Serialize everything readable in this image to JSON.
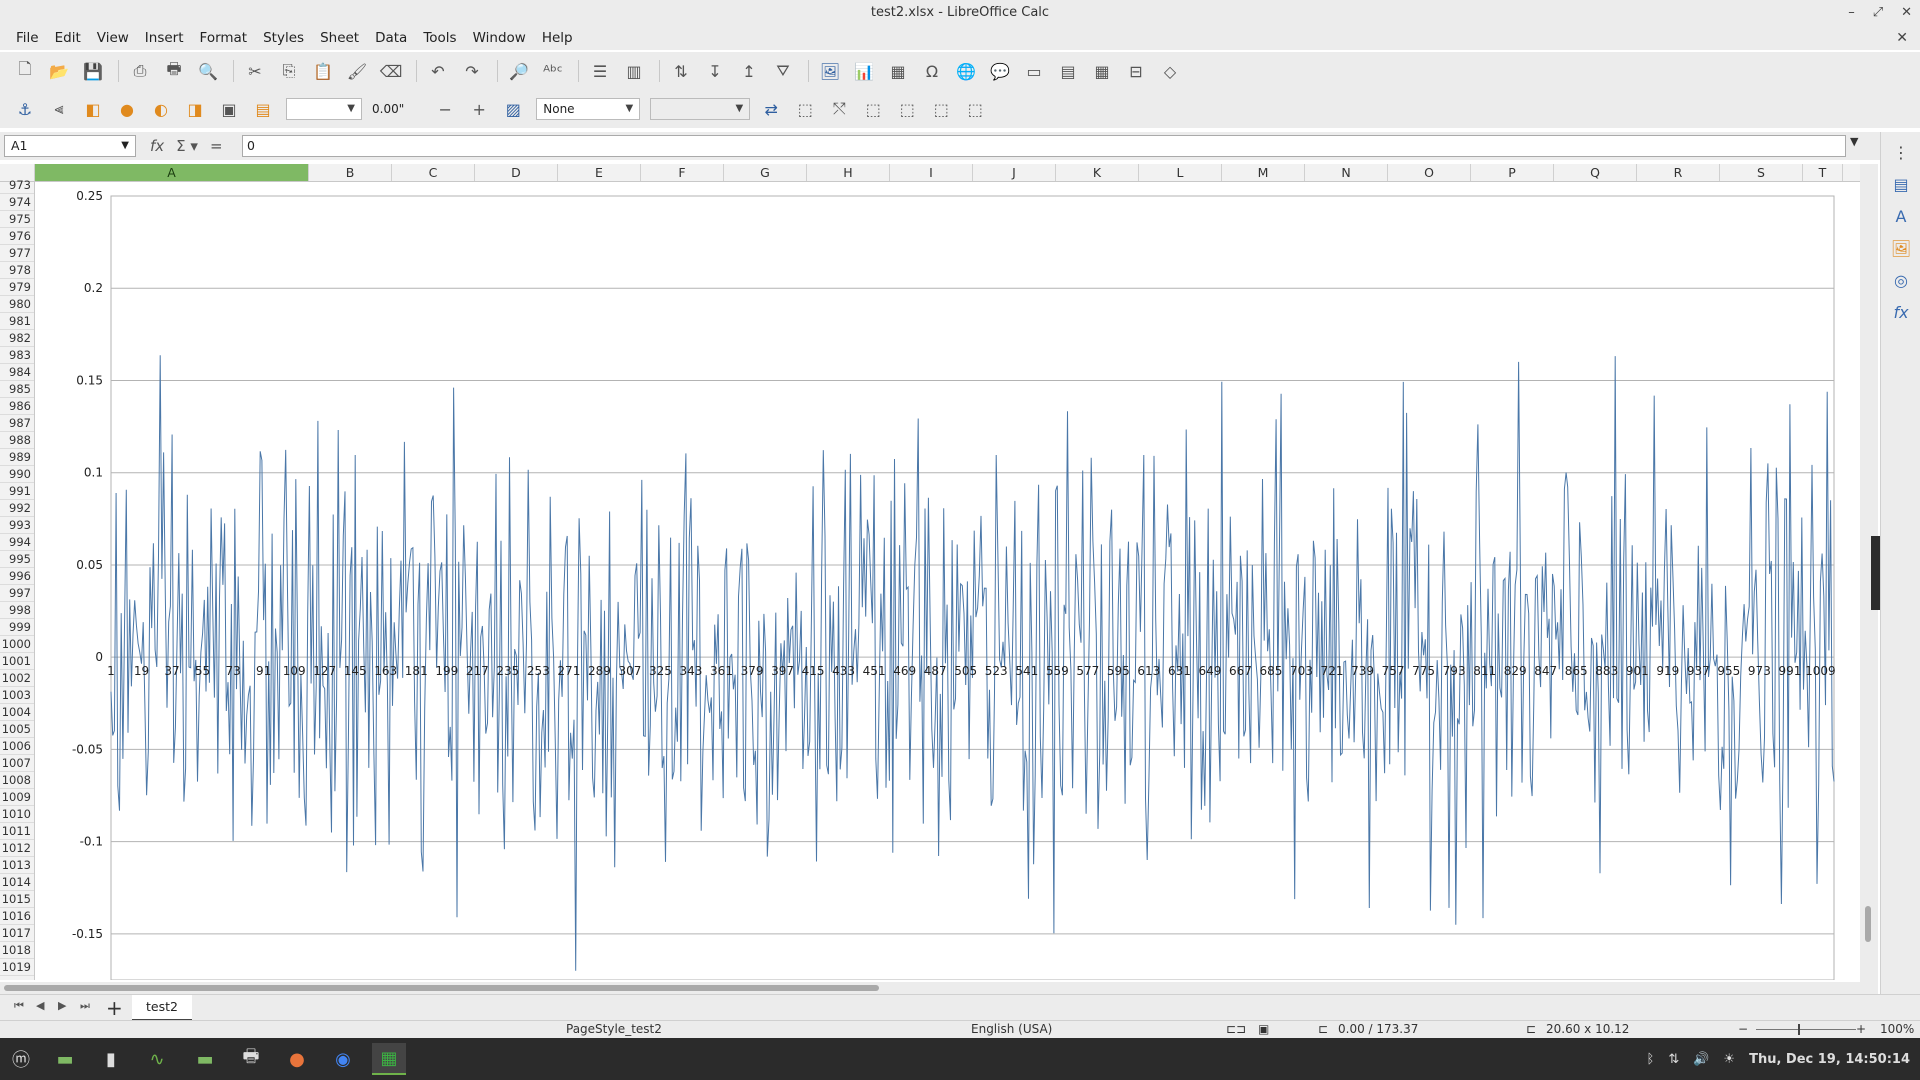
{
  "window": {
    "title": "test2.xlsx - LibreOffice Calc"
  },
  "menu": [
    "File",
    "Edit",
    "View",
    "Insert",
    "Format",
    "Styles",
    "Sheet",
    "Data",
    "Tools",
    "Window",
    "Help"
  ],
  "toolbar2": {
    "font_size_value": "0.00\"",
    "line_style_value": "None"
  },
  "formula_bar": {
    "cell_ref": "A1",
    "formula_value": "0",
    "icons": [
      "fx-icon",
      "sum-icon",
      "equals-icon"
    ]
  },
  "columns": [
    "A",
    "B",
    "C",
    "D",
    "E",
    "F",
    "G",
    "H",
    "I",
    "J",
    "K",
    "L",
    "M",
    "N",
    "O",
    "P",
    "Q",
    "R",
    "S",
    "T"
  ],
  "rows": {
    "first": 973,
    "last": 1019
  },
  "chart_data": {
    "type": "line",
    "ylim": [
      -0.175,
      0.25
    ],
    "yticks": [
      "0.25",
      "0.2",
      "0.15",
      "0.1",
      "0.05",
      "0",
      "-0.05",
      "-0.1",
      "-0.15"
    ],
    "xtick_labels": [
      "1",
      "19",
      "37",
      "55",
      "73",
      "91",
      "109",
      "127",
      "145",
      "163",
      "181",
      "199",
      "217",
      "235",
      "253",
      "271",
      "289",
      "307",
      "325",
      "343",
      "361",
      "379",
      "397",
      "415",
      "433",
      "451",
      "469",
      "487",
      "505",
      "523",
      "541",
      "559",
      "577",
      "595",
      "613",
      "631",
      "649",
      "667",
      "685",
      "703",
      "721",
      "739",
      "757",
      "775",
      "793",
      "811",
      "829",
      "847",
      "865",
      "883",
      "901",
      "919",
      "937",
      "955",
      "973",
      "991",
      "1009"
    ],
    "grid": true,
    "legend": "none",
    "series_color": "#4a77a8",
    "n_points": 1017,
    "x": [
      1,
      1017
    ]
  },
  "sheet_tab": "test2",
  "status": {
    "page_style": "PageStyle_test2",
    "language": "English (USA)",
    "position": "0.00 / 173.37",
    "size": "20.60 x 10.12",
    "zoom": "100%"
  },
  "taskbar": {
    "clock": "Thu, Dec 19, 14:50:14"
  }
}
